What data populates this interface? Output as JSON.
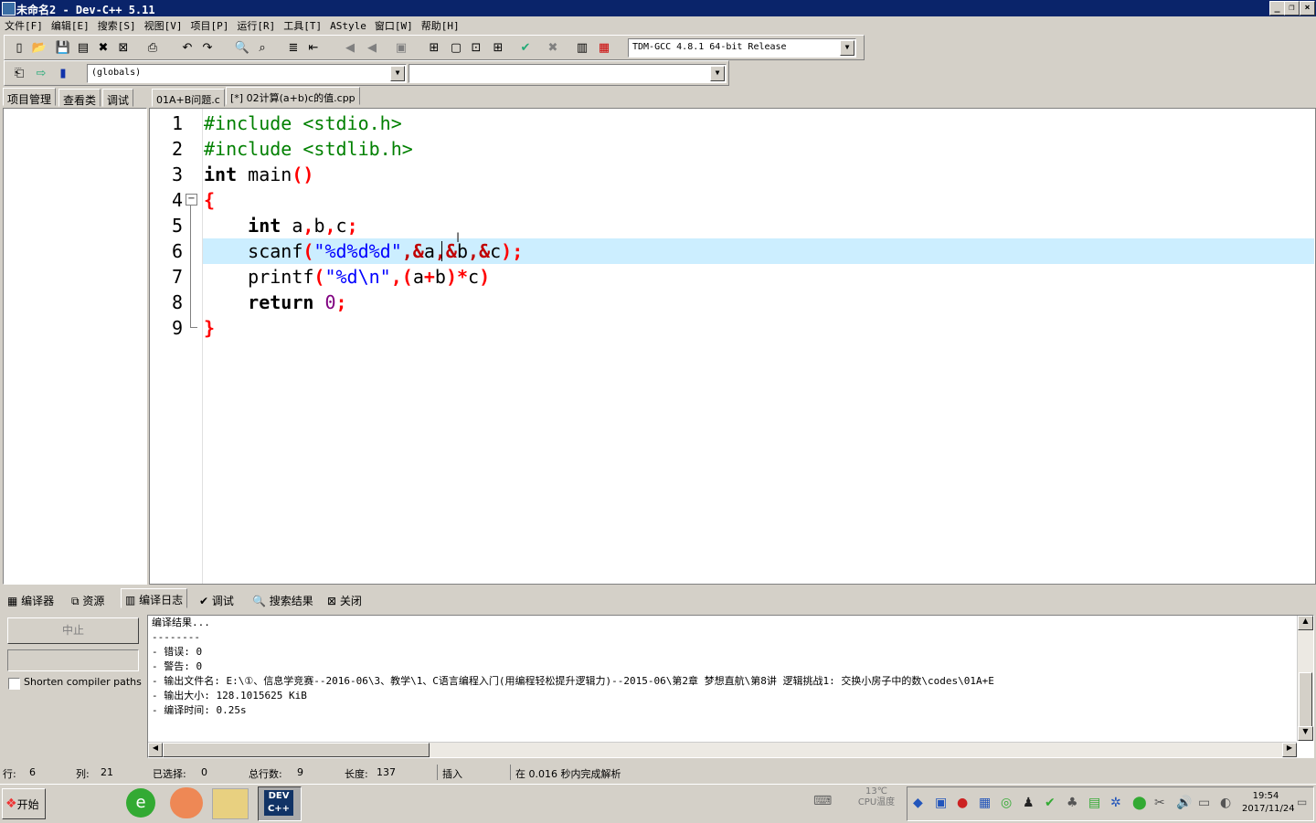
{
  "window": {
    "title": "未命名2 - Dev-C++ 5.11"
  },
  "menu": [
    "文件[F]",
    "编辑[E]",
    "搜索[S]",
    "视图[V]",
    "项目[P]",
    "运行[R]",
    "工具[T]",
    "AStyle",
    "窗口[W]",
    "帮助[H]"
  ],
  "toolbar": {
    "compiler_select": "TDM-GCC 4.8.1 64-bit Release",
    "scope_select": "(globals)",
    "function_select": ""
  },
  "left_tabs": [
    "项目管理",
    "查看类",
    "调试"
  ],
  "file_tabs": [
    "01A+B问题.c",
    "[*] 02计算(a+b)c的值.cpp"
  ],
  "editor": {
    "line_numbers": [
      "1",
      "2",
      "3",
      "4",
      "5",
      "6",
      "7",
      "8",
      "9"
    ],
    "current_line": 6,
    "lines": [
      [
        {
          "t": "#include <stdio.h>",
          "c": "pp"
        }
      ],
      [
        {
          "t": "#include <stdlib.h>",
          "c": "pp"
        }
      ],
      [
        {
          "t": "int",
          "c": "kw"
        },
        {
          "t": " main",
          "c": ""
        },
        {
          "t": "()",
          "c": "sym"
        }
      ],
      [
        {
          "t": "{",
          "c": "sym"
        }
      ],
      [
        {
          "t": "    ",
          "c": ""
        },
        {
          "t": "int",
          "c": "kw"
        },
        {
          "t": " a",
          "c": ""
        },
        {
          "t": ",",
          "c": "sym"
        },
        {
          "t": "b",
          "c": ""
        },
        {
          "t": ",",
          "c": "sym"
        },
        {
          "t": "c",
          "c": ""
        },
        {
          "t": ";",
          "c": "sym"
        }
      ],
      [
        {
          "t": "    scanf",
          "c": ""
        },
        {
          "t": "(",
          "c": "sym"
        },
        {
          "t": "\"%d%d%d\"",
          "c": "str"
        },
        {
          "t": ",&",
          "c": "amp"
        },
        {
          "t": "a",
          "c": ""
        },
        {
          "t": ",&",
          "c": "amp"
        },
        {
          "t": "b",
          "c": ""
        },
        {
          "t": ",&",
          "c": "amp"
        },
        {
          "t": "c",
          "c": ""
        },
        {
          "t": ");",
          "c": "sym"
        }
      ],
      [
        {
          "t": "    printf",
          "c": ""
        },
        {
          "t": "(",
          "c": "sym"
        },
        {
          "t": "\"%d\\n\"",
          "c": "str"
        },
        {
          "t": ",(",
          "c": "sym"
        },
        {
          "t": "a",
          "c": ""
        },
        {
          "t": "+",
          "c": "sym"
        },
        {
          "t": "b",
          "c": ""
        },
        {
          "t": ")*",
          "c": "sym"
        },
        {
          "t": "c",
          "c": ""
        },
        {
          "t": ")",
          "c": "sym"
        }
      ],
      [
        {
          "t": "    ",
          "c": ""
        },
        {
          "t": "return",
          "c": "kw"
        },
        {
          "t": " ",
          "c": ""
        },
        {
          "t": "0",
          "c": "num"
        },
        {
          "t": ";",
          "c": "sym"
        }
      ],
      [
        {
          "t": "}",
          "c": "sym"
        }
      ]
    ]
  },
  "bottom_tabs": [
    "编译器",
    "资源",
    "编译日志",
    "调试",
    "搜索结果",
    "关闭"
  ],
  "compile": {
    "abort_button": "中止",
    "shorten_label": "Shorten compiler paths",
    "output": [
      "编译结果...",
      "--------",
      "- 错误: 0",
      "- 警告: 0",
      "- 输出文件名: E:\\①、信息学竞赛--2016-06\\3、教学\\1、C语言编程入门(用编程轻松提升逻辑力)--2015-06\\第2章 梦想直航\\第8讲 逻辑挑战1: 交换小房子中的数\\codes\\01A+E",
      "- 输出大小: 128.1015625 KiB",
      "- 编译时间: 0.25s"
    ]
  },
  "status": {
    "row_label": "行:",
    "row": "6",
    "col_label": "列:",
    "col": "21",
    "sel_label": "已选择:",
    "sel": "0",
    "lines_label": "总行数:",
    "lines": "9",
    "len_label": "长度:",
    "len": "137",
    "mode": "插入",
    "parse": "在 0.016 秒内完成解析"
  },
  "taskbar": {
    "start": "开始",
    "temp": "13℃",
    "temp_label": "CPU温度",
    "time": "19:54",
    "date": "2017/11/24"
  }
}
